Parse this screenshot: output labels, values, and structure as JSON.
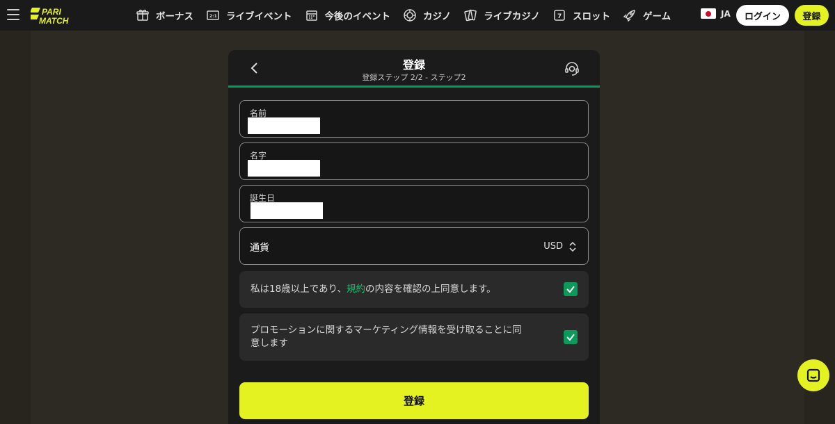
{
  "header": {
    "nav": [
      {
        "label": "ボーナス",
        "icon": "gift-icon"
      },
      {
        "label": "ライブイベント",
        "icon": "scoreboard-icon"
      },
      {
        "label": "今後のイベント",
        "icon": "calendar-icon"
      },
      {
        "label": "カジノ",
        "icon": "chip-icon"
      },
      {
        "label": "ライブカジノ",
        "icon": "cards-icon"
      },
      {
        "label": "スロット",
        "icon": "slot-icon"
      },
      {
        "label": "ゲーム",
        "icon": "rocket-icon"
      }
    ],
    "language": "JA",
    "login_label": "ログイン",
    "register_label": "登録"
  },
  "modal": {
    "title": "登録",
    "subtitle": "登録ステップ 2/2 - ステップ2",
    "fields": {
      "first_name_label": "名前",
      "last_name_label": "名字",
      "birthday_label": "誕生日",
      "currency_label": "通貨",
      "currency_value": "USD"
    },
    "terms": {
      "text_before": "私は18歳以上であり、",
      "link": "規約",
      "text_after": "の内容を確認の上同意します。",
      "checked": true
    },
    "marketing": {
      "line1": "プロモーションに関するマーケティング情報を受け取ることに同",
      "line2": "意します",
      "checked": true
    },
    "submit_label": "登録"
  },
  "colors": {
    "accent": "#e4f222",
    "success": "#0c9a5a",
    "link": "#16c26e",
    "background": "#28251f",
    "panel": "#1b1b1b"
  }
}
